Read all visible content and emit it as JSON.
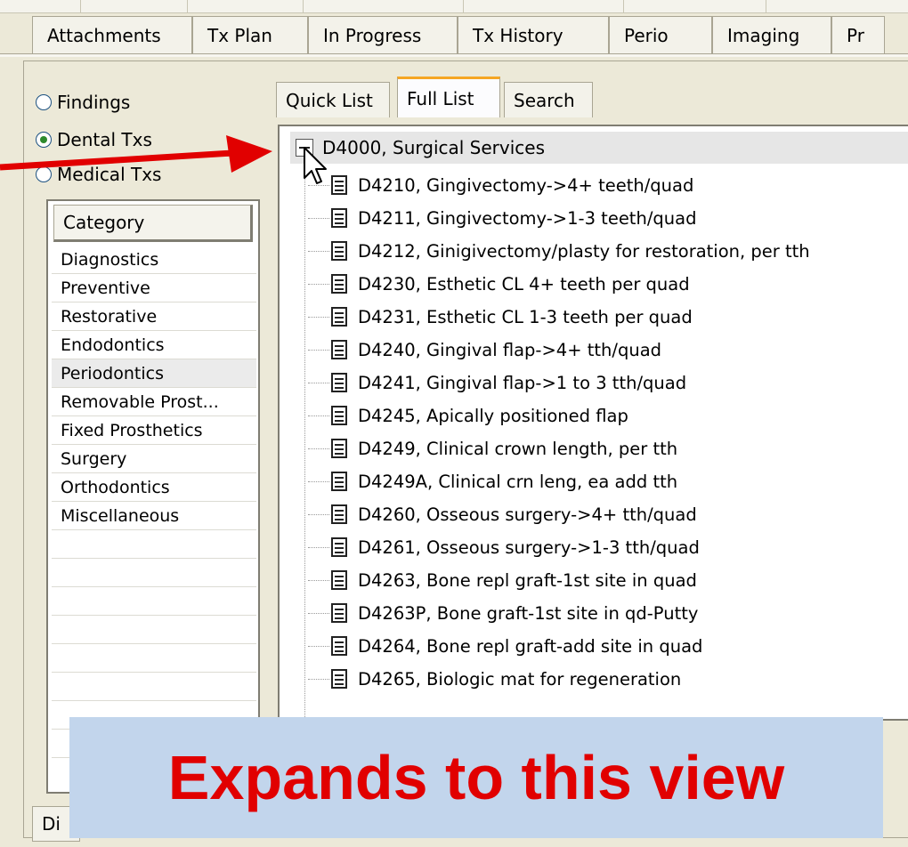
{
  "main_tabs": [
    "Attachments",
    "Tx Plan",
    "In Progress",
    "Tx History",
    "Perio",
    "Imaging",
    "Pr"
  ],
  "radio_options": [
    {
      "label": "Findings",
      "checked": false
    },
    {
      "label": "Dental Txs",
      "checked": true
    },
    {
      "label": "Medical Txs",
      "checked": false
    }
  ],
  "category": {
    "header": "Category",
    "items": [
      "Diagnostics",
      "Preventive",
      "Restorative",
      "Endodontics",
      "Periodontics",
      "Removable Prost...",
      "Fixed Prosthetics",
      "Surgery",
      "Orthodontics",
      "Miscellaneous"
    ],
    "selected": "Periodontics"
  },
  "sub_tabs": [
    "Quick List",
    "Full List",
    "Search"
  ],
  "active_sub_tab": "Full List",
  "tree": {
    "parent": "D4000, Surgical Services",
    "children": [
      "D4210, Gingivectomy->4+ teeth/quad",
      "D4211, Gingivectomy->1-3 teeth/quad",
      "D4212, Ginigivectomy/plasty for restoration, per tth",
      "D4230, Esthetic CL 4+ teeth per quad",
      "D4231, Esthetic CL 1-3 teeth per quad",
      "D4240, Gingival flap->4+ tth/quad",
      "D4241, Gingival flap->1 to 3 tth/quad",
      "D4245, Apically positioned flap",
      "D4249, Clinical crown length, per tth",
      "D4249A, Clinical crn leng, ea add tth",
      "D4260, Osseous surgery->4+ tth/quad",
      "D4261, Osseous surgery->1-3 tth/quad",
      "D4263, Bone repl graft-1st site in quad",
      "D4263P, Bone graft-1st site in qd-Putty",
      "D4264, Bone repl graft-add site in quad",
      "D4265, Biologic mat for regeneration"
    ]
  },
  "callout_text": "Expands to this view",
  "bottom_tab_label": "Di",
  "colors": {
    "arrow": "#e10000",
    "callout_bg": "#c2d5ec",
    "callout_text": "#e10000",
    "active_tab_accent": "#f5a623"
  }
}
